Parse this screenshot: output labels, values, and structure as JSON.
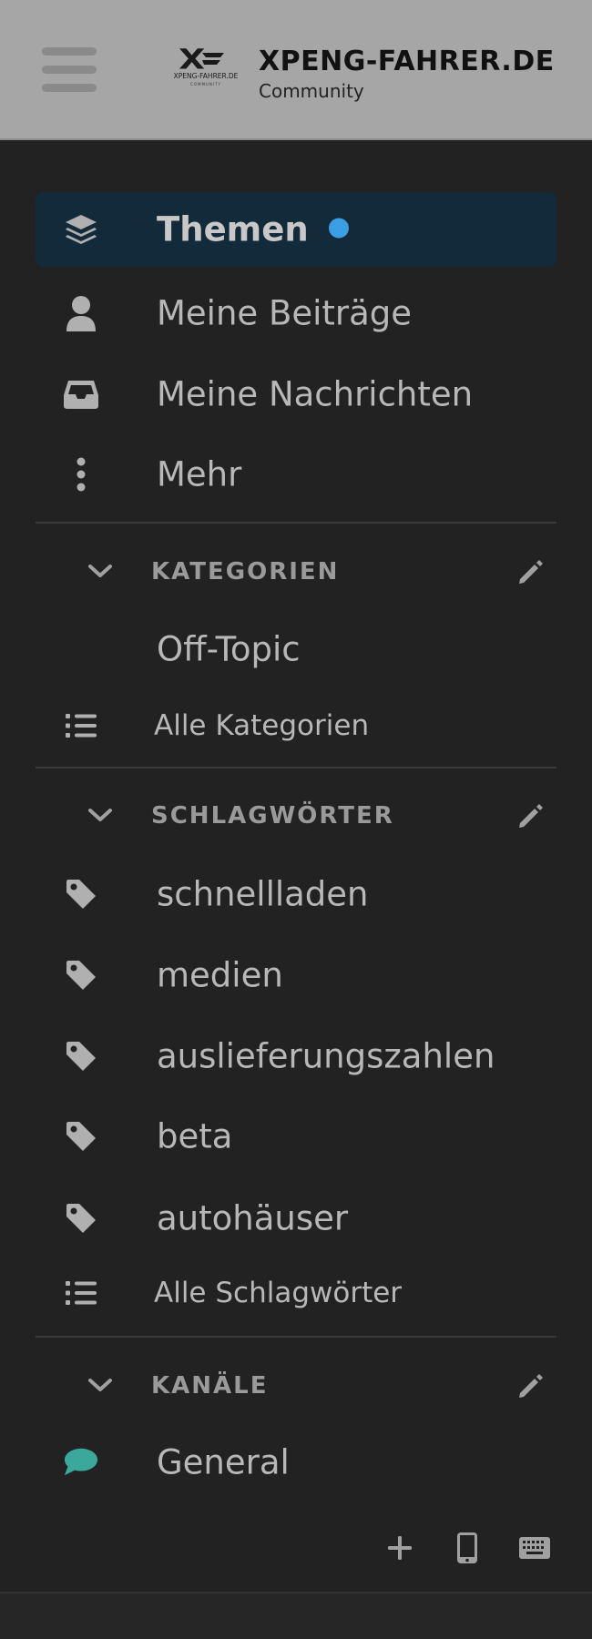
{
  "header": {
    "site_title": "XPENG-FAHRER.DE",
    "site_subtitle": "Community",
    "logo_small_text": "XPENG-FAHRER.DE",
    "logo_tiny_text": "COMMUNITY"
  },
  "nav": {
    "items": [
      {
        "label": "Themen",
        "icon": "layers-icon",
        "active": true,
        "has_new_dot": true
      },
      {
        "label": "Meine Beiträge",
        "icon": "user-icon"
      },
      {
        "label": "Meine Nachrichten",
        "icon": "inbox-icon"
      },
      {
        "label": "Mehr",
        "icon": "ellipsis-vertical-icon"
      }
    ]
  },
  "categories": {
    "title": "KATEGORIEN",
    "items": [
      {
        "label": "Off-Topic"
      }
    ],
    "all_label": "Alle Kategorien"
  },
  "tags": {
    "title": "SCHLAGWÖRTER",
    "items": [
      {
        "label": "schnellladen"
      },
      {
        "label": "medien"
      },
      {
        "label": "auslieferungszahlen"
      },
      {
        "label": "beta"
      },
      {
        "label": "autohäuser"
      }
    ],
    "all_label": "Alle Schlagwörter"
  },
  "channels": {
    "title": "KANÄLE",
    "items": [
      {
        "label": "General",
        "icon": "chat-bubble-icon",
        "color": "#3aa89a"
      }
    ]
  },
  "footer": {
    "icons": [
      "plus-icon",
      "mobile-icon",
      "keyboard-icon"
    ]
  },
  "colors": {
    "header_bg": "#a6a6a6",
    "sidebar_bg": "#222222",
    "active_bg": "#122a3a",
    "accent_dot": "#3b9fe3",
    "text": "#b8b8b8"
  }
}
